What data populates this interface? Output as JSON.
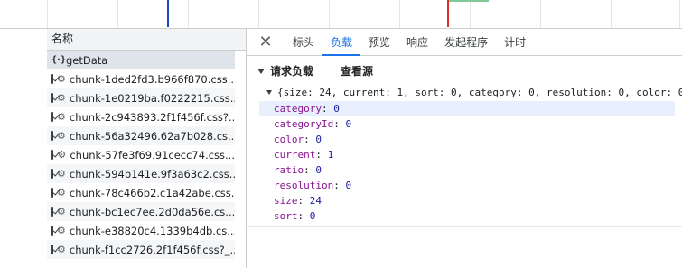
{
  "left_header": "名称",
  "requests": [
    {
      "type": "xhr",
      "icon": "xhr-icon",
      "name": "getData"
    },
    {
      "type": "css",
      "icon": "stylesheet-icon",
      "name": "chunk-1ded2fd3.b966f870.css..."
    },
    {
      "type": "css",
      "icon": "stylesheet-icon",
      "name": "chunk-1e0219ba.f0222215.css..."
    },
    {
      "type": "css",
      "icon": "stylesheet-icon",
      "name": "chunk-2c943893.2f1f456f.css?..."
    },
    {
      "type": "css",
      "icon": "stylesheet-icon",
      "name": "chunk-56a32496.62a7b028.cs..."
    },
    {
      "type": "css",
      "icon": "stylesheet-icon",
      "name": "chunk-57fe3f69.91cecc74.css..."
    },
    {
      "type": "css",
      "icon": "stylesheet-icon",
      "name": "chunk-594b141e.9f3a63c2.css..."
    },
    {
      "type": "css",
      "icon": "stylesheet-icon",
      "name": "chunk-78c466b2.c1a42abe.css..."
    },
    {
      "type": "css",
      "icon": "stylesheet-icon",
      "name": "chunk-bc1ec7ee.2d0da56e.cs..."
    },
    {
      "type": "css",
      "icon": "stylesheet-icon",
      "name": "chunk-e38820c4.1339b4db.cs..."
    },
    {
      "type": "css",
      "icon": "stylesheet-icon",
      "name": "chunk-f1cc2726.2f1f456f.css?_..."
    }
  ],
  "tabs": {
    "close": "✕",
    "headers": "标头",
    "payload": "负载",
    "preview": "预览",
    "response": "响应",
    "initiator": "发起程序",
    "timing": "计时"
  },
  "active_tab": "负载",
  "payload_section": {
    "title": "请求负载",
    "view_source": "查看源",
    "summary": "{size: 24, current: 1, sort: 0, category: 0, resolution: 0, color: 0",
    "properties": [
      {
        "key": "category",
        "value": "0"
      },
      {
        "key": "categoryId",
        "value": "0"
      },
      {
        "key": "color",
        "value": "0"
      },
      {
        "key": "current",
        "value": "1"
      },
      {
        "key": "ratio",
        "value": "0"
      },
      {
        "key": "resolution",
        "value": "0"
      },
      {
        "key": "size",
        "value": "24"
      },
      {
        "key": "sort",
        "value": "0"
      }
    ]
  },
  "colors": {
    "accent": "#1a73e8",
    "property_key": "#881391",
    "property_value": "#1a1aa6"
  }
}
